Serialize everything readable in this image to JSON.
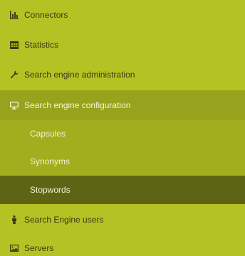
{
  "sidebar": {
    "items": [
      {
        "label": "Connectors",
        "icon": "bar-chart-icon"
      },
      {
        "label": "Statistics",
        "icon": "table-icon"
      },
      {
        "label": "Search engine administration",
        "icon": "wrench-icon"
      },
      {
        "label": "Search engine configuration",
        "icon": "monitor-icon",
        "active": true
      },
      {
        "label": "Search Engine users",
        "icon": "user-icon"
      },
      {
        "label": "Servers",
        "icon": "image-icon"
      }
    ],
    "subitems": [
      {
        "label": "Capsules"
      },
      {
        "label": "Synonyms"
      },
      {
        "label": "Stopwords",
        "selected": true
      }
    ]
  },
  "colors": {
    "background": "#b5c223",
    "active_background": "#97a31c",
    "submenu_background": "#a3ae1f",
    "selected_background": "#5d6515"
  }
}
